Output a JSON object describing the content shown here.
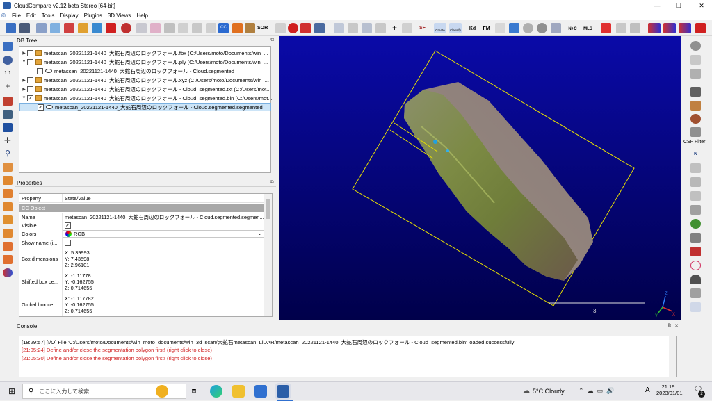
{
  "window": {
    "title": "CloudCompare v2.12 beta Stereo [64-bit]",
    "minimize": "—",
    "maximize": "❐",
    "close": "✕"
  },
  "menu": [
    "File",
    "Edit",
    "Tools",
    "Display",
    "Plugins",
    "3D Views",
    "Help"
  ],
  "toolbar": {
    "sor_label": "SOR",
    "sf_label": "SF",
    "canupo_label": "Create",
    "canupo_classify": "Classify",
    "kd_label": "Kd",
    "fm_label": "FM",
    "nc_label": "N+C",
    "mls_label": "MLS"
  },
  "left_toolbar": {
    "zoom_label": "1:1"
  },
  "db_tree": {
    "title": "DB Tree",
    "items": [
      {
        "label": "metascan_20221121-1440_大蛇石周辺のロックフォール.fbx (C:/Users/moto/Documents/win_...",
        "level": 0,
        "expanded": false,
        "checked": false
      },
      {
        "label": "metascan_20221121-1440_大蛇石周辺のロックフォール.ply (C:/Users/moto/Documents/win_...",
        "level": 0,
        "expanded": true,
        "checked": false
      },
      {
        "label": "metascan_20221121-1440_大蛇石周辺のロックフォール - Cloud.segmented",
        "level": 1,
        "expanded": false,
        "checked": false
      },
      {
        "label": "metascan_20221121-1440_大蛇石周辺のロックフォール.xyz (C:/Users/moto/Documents/win_...",
        "level": 0,
        "expanded": false,
        "checked": false
      },
      {
        "label": "metascan_20221121-1440_大蛇石周辺のロックフォール - Cloud_segmented.txt (C:/Users/mot...",
        "level": 0,
        "expanded": false,
        "checked": false
      },
      {
        "label": "metascan_20221121-1440_大蛇石周辺のロックフォール - Cloud_segmented.bin (C:/Users/mot...",
        "level": 0,
        "expanded": true,
        "checked": true
      },
      {
        "label": "metascan_20221121-1440_大蛇石周辺のロックフォール - Cloud.segmented.segmented",
        "level": 1,
        "expanded": false,
        "checked": true
      }
    ]
  },
  "properties": {
    "title": "Properties",
    "col_property": "Property",
    "col_value": "State/Value",
    "section": "CC Object",
    "name_label": "Name",
    "name_value": "metascan_20221121-1440_大蛇石周辺のロックフォール - Cloud.segmented.segmen...",
    "visible_label": "Visible",
    "colors_label": "Colors",
    "colors_value": "RGB",
    "showname_label": "Show name (i...",
    "box_dim_label": "Box dimensions",
    "box_dim": [
      "X: 5.39993",
      "Y: 7.43598",
      "Z: 2.96101"
    ],
    "shifted_label": "Shifted box ce...",
    "shifted": [
      "X: -1.11778",
      "Y: -0.162755",
      "Z: 0.714655"
    ],
    "global_label": "Global box ce...",
    "global": [
      "X: -1.117782",
      "Y: -0.162755",
      "Z: 0.714655"
    ]
  },
  "viewport": {
    "scale_label": "3",
    "axis_x": "X",
    "axis_y": "Y",
    "axis_z": "Z"
  },
  "right_toolbar": {
    "csf_label": "CSF Filter",
    "n_label": "N"
  },
  "console": {
    "title": "Console",
    "lines": [
      {
        "text": "[18:29:57] [I/O] File 'C:/Users/moto/Documents/win_moto_documents/win_3d_scan/大蛇石metascan_LiDAR/metascan_20221121-1440_大蛇石周辺のロックフォール - Cloud_segmented.bin' loaded successfully",
        "color": "#000000"
      },
      {
        "text": "[21:05:24] Define and/or close the segmentation polygon first! (right click to close)",
        "color": "#d02020"
      },
      {
        "text": "[21:05:30] Define and/or close the segmentation polygon first! (right click to close)",
        "color": "#d02020"
      }
    ]
  },
  "taskbar": {
    "search_placeholder": "ここに入力して検索",
    "weather": "5°C  Cloudy",
    "ime": "A",
    "time": "21:19",
    "date": "2023/01/01",
    "notification_count": "2"
  }
}
